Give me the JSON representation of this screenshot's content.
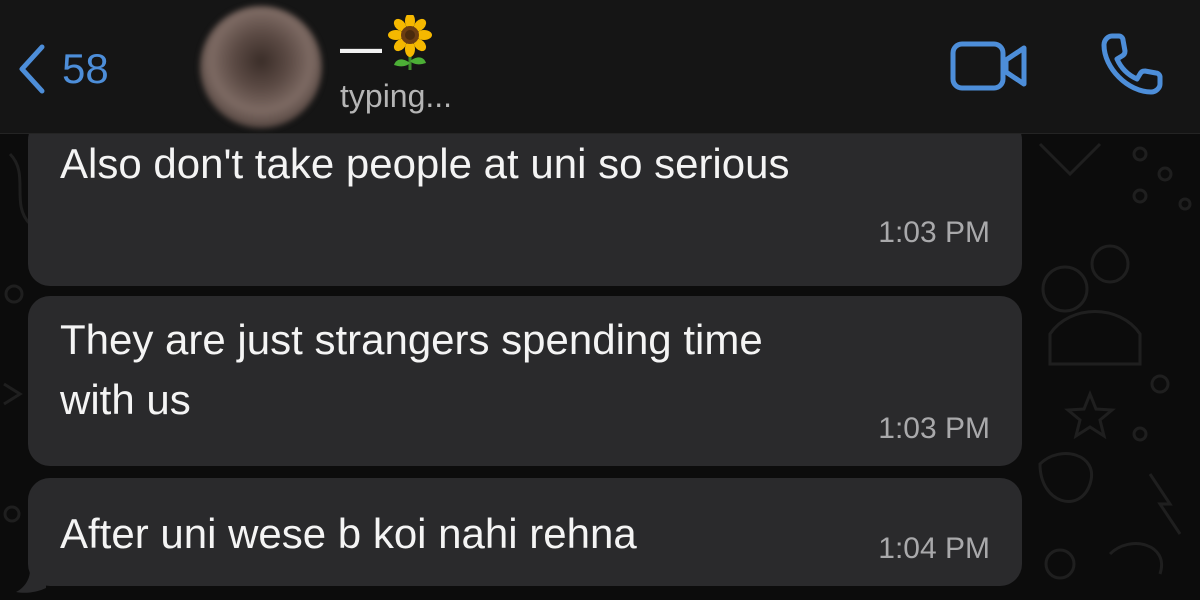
{
  "header": {
    "back_count": "58",
    "contact_name": "—",
    "contact_emoji": "sunflower-emoji",
    "status": "typing...",
    "icons": {
      "back": "chevron-left-icon",
      "video": "video-camera-icon",
      "call": "phone-icon"
    }
  },
  "messages": [
    {
      "text": "Also don't take people at uni so serious",
      "time": "1:03 PM"
    },
    {
      "text": "They are just strangers spending time\nwith us",
      "time": "1:03 PM"
    },
    {
      "text": "After uni wese b koi nahi rehna",
      "time": "1:04 PM"
    }
  ],
  "colors": {
    "accent": "#4d8ed9",
    "header_bg": "#151515",
    "bubble_bg": "#2a2a2c",
    "chat_bg": "#0c0c0c",
    "text": "#f4f4f4",
    "timestamp": "#a9a9ab"
  }
}
